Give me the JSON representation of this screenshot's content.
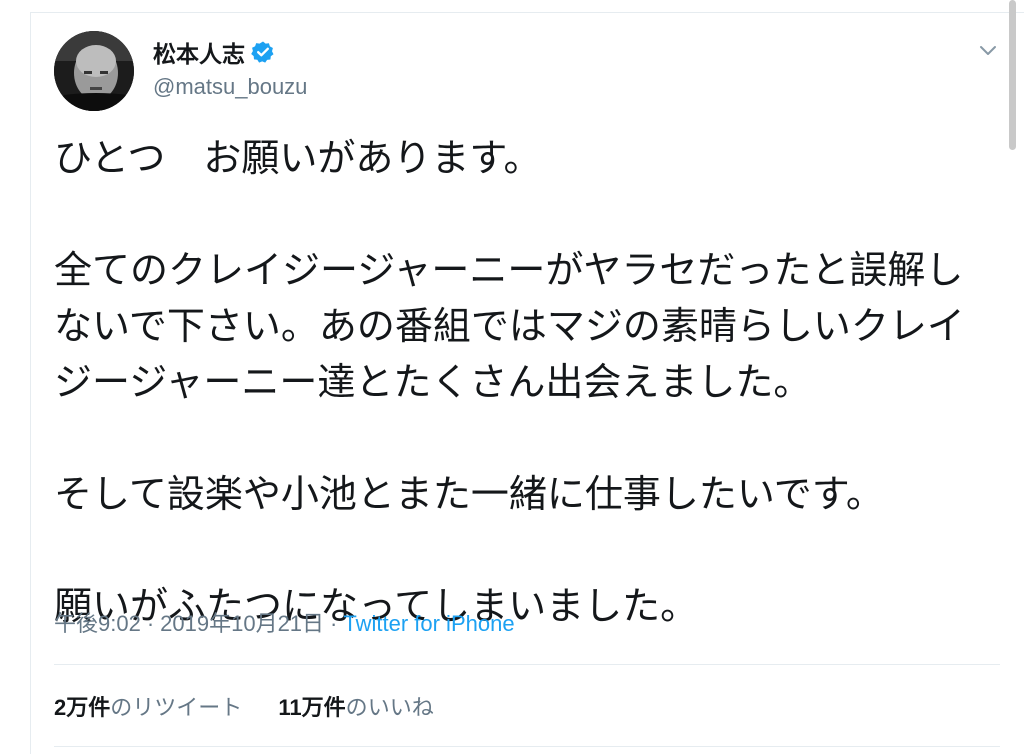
{
  "user": {
    "display_name": "松本人志",
    "handle": "@matsu_bouzu",
    "verified": true
  },
  "tweet": {
    "lines": [
      "ひとつ　お願いがあります。",
      "",
      "全てのクレイジージャーニーがヤラセだったと誤解し",
      "ないで下さい。あの番組ではマジの素晴らしいクレイ",
      "ジージャーニー達とたくさん出会えました。",
      "",
      "そして設楽や小池とまた一緒に仕事したいです。",
      "",
      "願いがふたつになってしまいました。"
    ],
    "time": "午後9:02",
    "separator": "·",
    "date": "2019年10月21日",
    "source": "Twitter for iPhone"
  },
  "stats": {
    "retweets_count": "2万件",
    "retweets_label_prefix": "の",
    "retweets_label": "リツイート",
    "likes_count": "11万件",
    "likes_label_prefix": "の",
    "likes_label": "いいね"
  },
  "colors": {
    "text": "#14171a",
    "secondary": "#657786",
    "link": "#1da1f2",
    "verified": "#1da1f2",
    "divider": "#e6ecf0"
  },
  "icons": {
    "verified": "verified-badge-icon",
    "caret": "chevron-down-icon"
  }
}
